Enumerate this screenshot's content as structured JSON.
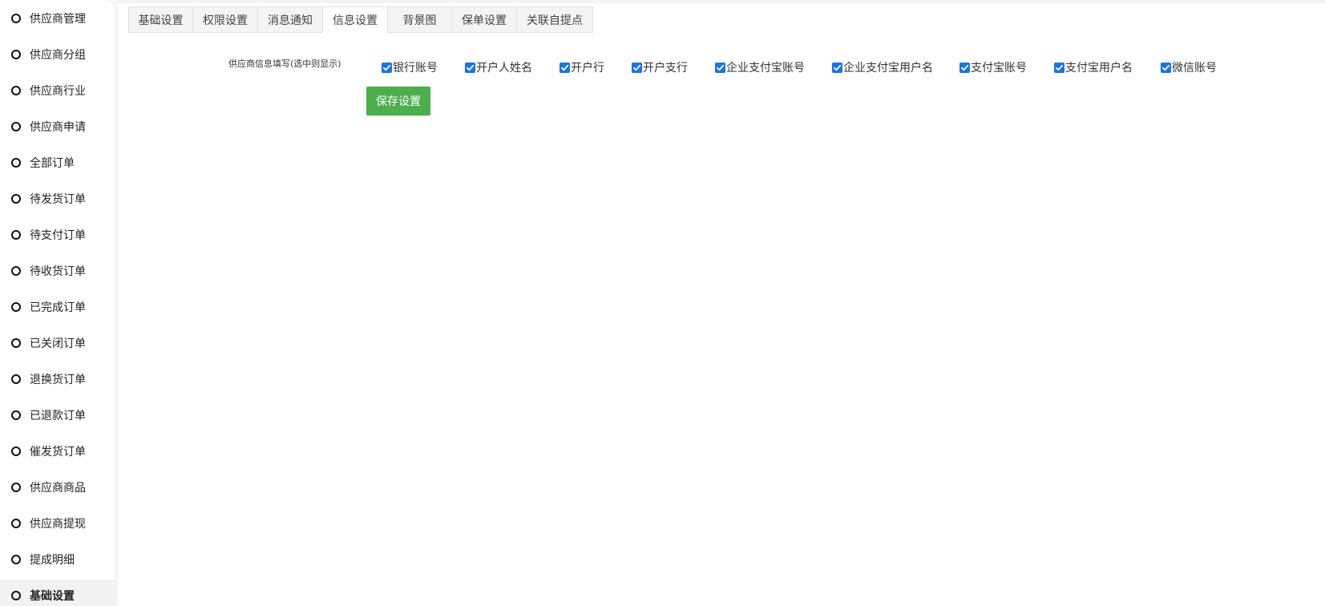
{
  "sidebar": {
    "items": [
      {
        "label": "供应商管理"
      },
      {
        "label": "供应商分组"
      },
      {
        "label": "供应商行业"
      },
      {
        "label": "供应商申请"
      },
      {
        "label": "全部订单"
      },
      {
        "label": "待发货订单"
      },
      {
        "label": "待支付订单"
      },
      {
        "label": "待收货订单"
      },
      {
        "label": "已完成订单"
      },
      {
        "label": "已关闭订单"
      },
      {
        "label": "退换货订单"
      },
      {
        "label": "已退款订单"
      },
      {
        "label": "催发货订单"
      },
      {
        "label": "供应商商品"
      },
      {
        "label": "供应商提现"
      },
      {
        "label": "提成明细"
      },
      {
        "label": "基础设置"
      }
    ],
    "active_index": 16
  },
  "tabs": [
    {
      "label": "基础设置"
    },
    {
      "label": "权限设置"
    },
    {
      "label": "消息通知"
    },
    {
      "label": "信息设置"
    },
    {
      "label": "背景图"
    },
    {
      "label": "保单设置"
    },
    {
      "label": "关联自提点"
    }
  ],
  "active_tab": 3,
  "form": {
    "field_label": "供应商信息填写(选中则显示)",
    "checkboxes": [
      {
        "label": "银行账号",
        "checked": true
      },
      {
        "label": "开户人姓名",
        "checked": true
      },
      {
        "label": "开户行",
        "checked": true
      },
      {
        "label": "开户支行",
        "checked": true
      },
      {
        "label": "企业支付宝账号",
        "checked": true
      },
      {
        "label": "企业支付宝用户名",
        "checked": true
      },
      {
        "label": "支付宝账号",
        "checked": true
      },
      {
        "label": "支付宝用户名",
        "checked": true
      },
      {
        "label": "微信账号",
        "checked": true
      }
    ],
    "save_label": "保存设置"
  },
  "colors": {
    "checkbox": "#1a73e8",
    "save_button": "#4cae4c"
  }
}
